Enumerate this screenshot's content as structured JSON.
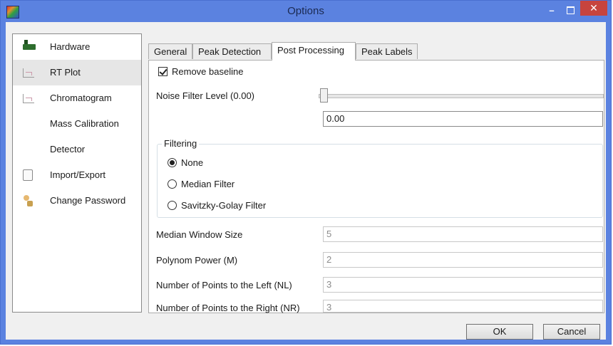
{
  "window": {
    "title": "Options",
    "controls": {
      "minimize": "–",
      "maximize": "",
      "close": "✕"
    }
  },
  "sidebar": {
    "items": [
      {
        "label": "Hardware",
        "icon": "hardware-icon"
      },
      {
        "label": "RT Plot",
        "icon": "plot-icon",
        "selected": true
      },
      {
        "label": "Chromatogram",
        "icon": "chromatogram-icon"
      },
      {
        "label": "Mass Calibration",
        "icon": ""
      },
      {
        "label": "Detector",
        "icon": ""
      },
      {
        "label": "Import/Export",
        "icon": "import-export-icon"
      },
      {
        "label": "Change Password",
        "icon": "user-key-icon"
      }
    ]
  },
  "tabs": [
    {
      "label": "General"
    },
    {
      "label": "Peak Detection"
    },
    {
      "label": "Post Processing",
      "active": true
    },
    {
      "label": "Peak Labels"
    }
  ],
  "post_processing": {
    "remove_baseline": {
      "label": "Remove baseline",
      "checked": true
    },
    "noise_filter": {
      "label": "Noise Filter Level (0.00)",
      "value": "0.00",
      "slider_fraction": 0.0
    },
    "filtering": {
      "title": "Filtering",
      "options": [
        {
          "label": "None",
          "checked": true
        },
        {
          "label": "Median Filter",
          "checked": false
        },
        {
          "label": "Savitzky-Golay Filter",
          "checked": false
        }
      ]
    },
    "fields": [
      {
        "label": "Median Window Size",
        "value": "5"
      },
      {
        "label": "Polynom Power (M)",
        "value": "2"
      },
      {
        "label": "Number of Points to the Left (NL)",
        "value": "3"
      },
      {
        "label": "Number of Points to the Right (NR)",
        "value": "3"
      }
    ]
  },
  "buttons": {
    "ok": "OK",
    "cancel": "Cancel"
  },
  "colors": {
    "titlebar": "#5b82e0",
    "close_button": "#c7443e"
  }
}
